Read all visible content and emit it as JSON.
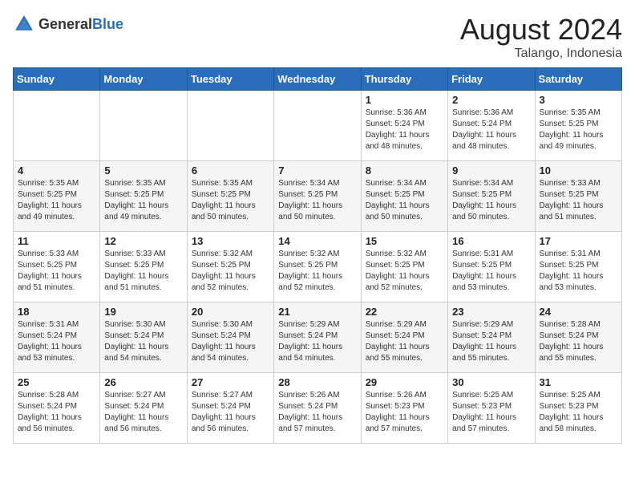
{
  "logo": {
    "general": "General",
    "blue": "Blue"
  },
  "header": {
    "month": "August 2024",
    "location": "Talango, Indonesia"
  },
  "weekdays": [
    "Sunday",
    "Monday",
    "Tuesday",
    "Wednesday",
    "Thursday",
    "Friday",
    "Saturday"
  ],
  "weeks": [
    [
      {
        "day": "",
        "info": ""
      },
      {
        "day": "",
        "info": ""
      },
      {
        "day": "",
        "info": ""
      },
      {
        "day": "",
        "info": ""
      },
      {
        "day": "1",
        "sunrise": "5:36 AM",
        "sunset": "5:24 PM",
        "daylight": "11 hours and 48 minutes."
      },
      {
        "day": "2",
        "sunrise": "5:36 AM",
        "sunset": "5:24 PM",
        "daylight": "11 hours and 48 minutes."
      },
      {
        "day": "3",
        "sunrise": "5:35 AM",
        "sunset": "5:25 PM",
        "daylight": "11 hours and 49 minutes."
      }
    ],
    [
      {
        "day": "4",
        "sunrise": "5:35 AM",
        "sunset": "5:25 PM",
        "daylight": "11 hours and 49 minutes."
      },
      {
        "day": "5",
        "sunrise": "5:35 AM",
        "sunset": "5:25 PM",
        "daylight": "11 hours and 49 minutes."
      },
      {
        "day": "6",
        "sunrise": "5:35 AM",
        "sunset": "5:25 PM",
        "daylight": "11 hours and 50 minutes."
      },
      {
        "day": "7",
        "sunrise": "5:34 AM",
        "sunset": "5:25 PM",
        "daylight": "11 hours and 50 minutes."
      },
      {
        "day": "8",
        "sunrise": "5:34 AM",
        "sunset": "5:25 PM",
        "daylight": "11 hours and 50 minutes."
      },
      {
        "day": "9",
        "sunrise": "5:34 AM",
        "sunset": "5:25 PM",
        "daylight": "11 hours and 50 minutes."
      },
      {
        "day": "10",
        "sunrise": "5:33 AM",
        "sunset": "5:25 PM",
        "daylight": "11 hours and 51 minutes."
      }
    ],
    [
      {
        "day": "11",
        "sunrise": "5:33 AM",
        "sunset": "5:25 PM",
        "daylight": "11 hours and 51 minutes."
      },
      {
        "day": "12",
        "sunrise": "5:33 AM",
        "sunset": "5:25 PM",
        "daylight": "11 hours and 51 minutes."
      },
      {
        "day": "13",
        "sunrise": "5:32 AM",
        "sunset": "5:25 PM",
        "daylight": "11 hours and 52 minutes."
      },
      {
        "day": "14",
        "sunrise": "5:32 AM",
        "sunset": "5:25 PM",
        "daylight": "11 hours and 52 minutes."
      },
      {
        "day": "15",
        "sunrise": "5:32 AM",
        "sunset": "5:25 PM",
        "daylight": "11 hours and 52 minutes."
      },
      {
        "day": "16",
        "sunrise": "5:31 AM",
        "sunset": "5:25 PM",
        "daylight": "11 hours and 53 minutes."
      },
      {
        "day": "17",
        "sunrise": "5:31 AM",
        "sunset": "5:25 PM",
        "daylight": "11 hours and 53 minutes."
      }
    ],
    [
      {
        "day": "18",
        "sunrise": "5:31 AM",
        "sunset": "5:24 PM",
        "daylight": "11 hours and 53 minutes."
      },
      {
        "day": "19",
        "sunrise": "5:30 AM",
        "sunset": "5:24 PM",
        "daylight": "11 hours and 54 minutes."
      },
      {
        "day": "20",
        "sunrise": "5:30 AM",
        "sunset": "5:24 PM",
        "daylight": "11 hours and 54 minutes."
      },
      {
        "day": "21",
        "sunrise": "5:29 AM",
        "sunset": "5:24 PM",
        "daylight": "11 hours and 54 minutes."
      },
      {
        "day": "22",
        "sunrise": "5:29 AM",
        "sunset": "5:24 PM",
        "daylight": "11 hours and 55 minutes."
      },
      {
        "day": "23",
        "sunrise": "5:29 AM",
        "sunset": "5:24 PM",
        "daylight": "11 hours and 55 minutes."
      },
      {
        "day": "24",
        "sunrise": "5:28 AM",
        "sunset": "5:24 PM",
        "daylight": "11 hours and 55 minutes."
      }
    ],
    [
      {
        "day": "25",
        "sunrise": "5:28 AM",
        "sunset": "5:24 PM",
        "daylight": "11 hours and 56 minutes."
      },
      {
        "day": "26",
        "sunrise": "5:27 AM",
        "sunset": "5:24 PM",
        "daylight": "11 hours and 56 minutes."
      },
      {
        "day": "27",
        "sunrise": "5:27 AM",
        "sunset": "5:24 PM",
        "daylight": "11 hours and 56 minutes."
      },
      {
        "day": "28",
        "sunrise": "5:26 AM",
        "sunset": "5:24 PM",
        "daylight": "11 hours and 57 minutes."
      },
      {
        "day": "29",
        "sunrise": "5:26 AM",
        "sunset": "5:23 PM",
        "daylight": "11 hours and 57 minutes."
      },
      {
        "day": "30",
        "sunrise": "5:25 AM",
        "sunset": "5:23 PM",
        "daylight": "11 hours and 57 minutes."
      },
      {
        "day": "31",
        "sunrise": "5:25 AM",
        "sunset": "5:23 PM",
        "daylight": "11 hours and 58 minutes."
      }
    ]
  ],
  "labels": {
    "sunrise": "Sunrise:",
    "sunset": "Sunset:",
    "daylight": "Daylight:"
  }
}
